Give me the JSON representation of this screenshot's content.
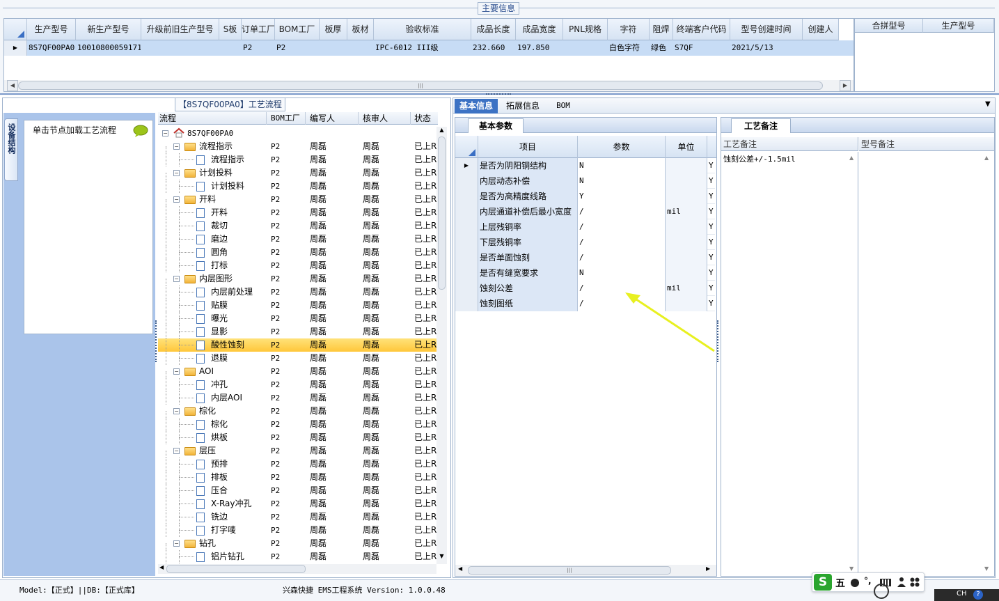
{
  "top": {
    "section_title": "主要信息",
    "columns": [
      "生产型号",
      "新生产型号",
      "升级前旧生产型号",
      "S板",
      "订单工厂",
      "BOM工厂",
      "板厚",
      "板材",
      "验收标准",
      "成品长度",
      "成品宽度",
      "PNL规格",
      "字符",
      "阻焊",
      "终端客户代码",
      "型号创建时间",
      "创建人"
    ],
    "row": [
      "8S7QF00PA0",
      "10010800059171",
      "",
      "",
      "P2",
      "P2",
      "",
      "",
      "IPC-6012 III级",
      "232.660",
      "197.850",
      "",
      "白色字符",
      "绿色",
      "S7QF",
      "2021/5/13",
      ""
    ],
    "side_columns": [
      "合拼型号",
      "生产型号"
    ]
  },
  "left_panel": {
    "vtab": "设备结构",
    "hint": "单击节点加载工艺流程",
    "flow_title": "【8S7QF00PA0】工艺流程",
    "columns": [
      "流程",
      "BOM工厂",
      "编写人",
      "核审人",
      "状态"
    ],
    "root": "8S7QF00PA0",
    "rows": [
      {
        "label": "流程指示",
        "type": "folder",
        "f": "P2",
        "w": "周磊",
        "r": "周磊",
        "s": "已上R"
      },
      {
        "label": "流程指示",
        "type": "file",
        "f": "P2",
        "w": "周磊",
        "r": "周磊",
        "s": "已上R"
      },
      {
        "label": "计划投料",
        "type": "folder",
        "f": "P2",
        "w": "周磊",
        "r": "周磊",
        "s": "已上R"
      },
      {
        "label": "计划投料",
        "type": "file",
        "f": "P2",
        "w": "周磊",
        "r": "周磊",
        "s": "已上R"
      },
      {
        "label": "开料",
        "type": "folder",
        "f": "P2",
        "w": "周磊",
        "r": "周磊",
        "s": "已上R"
      },
      {
        "label": "开料",
        "type": "file",
        "f": "P2",
        "w": "周磊",
        "r": "周磊",
        "s": "已上R"
      },
      {
        "label": "裁切",
        "type": "file",
        "f": "P2",
        "w": "周磊",
        "r": "周磊",
        "s": "已上R"
      },
      {
        "label": "磨边",
        "type": "file",
        "f": "P2",
        "w": "周磊",
        "r": "周磊",
        "s": "已上R"
      },
      {
        "label": "圆角",
        "type": "file",
        "f": "P2",
        "w": "周磊",
        "r": "周磊",
        "s": "已上R"
      },
      {
        "label": "打标",
        "type": "file",
        "f": "P2",
        "w": "周磊",
        "r": "周磊",
        "s": "已上R"
      },
      {
        "label": "内层图形",
        "type": "folder",
        "f": "P2",
        "w": "周磊",
        "r": "周磊",
        "s": "已上R"
      },
      {
        "label": "内层前处理",
        "type": "file",
        "f": "P2",
        "w": "周磊",
        "r": "周磊",
        "s": "已上R"
      },
      {
        "label": "贴膜",
        "type": "file",
        "f": "P2",
        "w": "周磊",
        "r": "周磊",
        "s": "已上R"
      },
      {
        "label": "曝光",
        "type": "file",
        "f": "P2",
        "w": "周磊",
        "r": "周磊",
        "s": "已上R"
      },
      {
        "label": "显影",
        "type": "file",
        "f": "P2",
        "w": "周磊",
        "r": "周磊",
        "s": "已上R"
      },
      {
        "label": "酸性蚀刻",
        "type": "file",
        "f": "P2",
        "w": "周磊",
        "r": "周磊",
        "s": "已上R",
        "sel": true
      },
      {
        "label": "退膜",
        "type": "file",
        "f": "P2",
        "w": "周磊",
        "r": "周磊",
        "s": "已上R"
      },
      {
        "label": "AOI",
        "type": "folder",
        "f": "P2",
        "w": "周磊",
        "r": "周磊",
        "s": "已上R"
      },
      {
        "label": "冲孔",
        "type": "file",
        "f": "P2",
        "w": "周磊",
        "r": "周磊",
        "s": "已上R"
      },
      {
        "label": "内层AOI",
        "type": "file",
        "f": "P2",
        "w": "周磊",
        "r": "周磊",
        "s": "已上R"
      },
      {
        "label": "棕化",
        "type": "folder",
        "f": "P2",
        "w": "周磊",
        "r": "周磊",
        "s": "已上R"
      },
      {
        "label": "棕化",
        "type": "file",
        "f": "P2",
        "w": "周磊",
        "r": "周磊",
        "s": "已上R"
      },
      {
        "label": "烘板",
        "type": "file",
        "f": "P2",
        "w": "周磊",
        "r": "周磊",
        "s": "已上R"
      },
      {
        "label": "层压",
        "type": "folder",
        "f": "P2",
        "w": "周磊",
        "r": "周磊",
        "s": "已上R"
      },
      {
        "label": "预排",
        "type": "file",
        "f": "P2",
        "w": "周磊",
        "r": "周磊",
        "s": "已上R"
      },
      {
        "label": "排板",
        "type": "file",
        "f": "P2",
        "w": "周磊",
        "r": "周磊",
        "s": "已上R"
      },
      {
        "label": "压合",
        "type": "file",
        "f": "P2",
        "w": "周磊",
        "r": "周磊",
        "s": "已上R"
      },
      {
        "label": "X-Ray冲孔",
        "type": "file",
        "f": "P2",
        "w": "周磊",
        "r": "周磊",
        "s": "已上R"
      },
      {
        "label": "铣边",
        "type": "file",
        "f": "P2",
        "w": "周磊",
        "r": "周磊",
        "s": "已上R"
      },
      {
        "label": "打字唛",
        "type": "file",
        "f": "P2",
        "w": "周磊",
        "r": "周磊",
        "s": "已上R"
      },
      {
        "label": "钻孔",
        "type": "folder",
        "f": "P2",
        "w": "周磊",
        "r": "周磊",
        "s": "已上R"
      },
      {
        "label": "铝片钻孔",
        "type": "file",
        "f": "P2",
        "w": "周磊",
        "r": "周磊",
        "s": "已上R"
      }
    ]
  },
  "right_panel": {
    "tabs": [
      "基本信息",
      "拓展信息",
      "BOM"
    ],
    "sub_tab": "基本参数",
    "param_columns": [
      "项目",
      "参数",
      "单位"
    ],
    "params": [
      {
        "item": "是否为阴阳铜结构",
        "value": "N",
        "unit": "",
        "flag": "Y"
      },
      {
        "item": "内层动态补偿",
        "value": "N",
        "unit": "",
        "flag": "Y"
      },
      {
        "item": "是否为高精度线路",
        "value": "Y",
        "unit": "",
        "flag": "Y"
      },
      {
        "item": "内层通道补偿后最小宽度",
        "value": "/",
        "unit": "mil",
        "flag": "Y"
      },
      {
        "item": "上层残铜率",
        "value": "/",
        "unit": "",
        "flag": "Y"
      },
      {
        "item": "下层残铜率",
        "value": "/",
        "unit": "",
        "flag": "Y"
      },
      {
        "item": "是否单面蚀刻",
        "value": "/",
        "unit": "",
        "flag": "Y"
      },
      {
        "item": "是否有缝宽要求",
        "value": "N",
        "unit": "",
        "flag": "Y"
      },
      {
        "item": "蚀刻公差",
        "value": "/",
        "unit": "mil",
        "flag": "Y"
      },
      {
        "item": "蚀刻图纸",
        "value": "/",
        "unit": "",
        "flag": "Y"
      }
    ],
    "remark_tab": "工艺备注",
    "remark_columns": [
      "工艺备注",
      "型号备注"
    ],
    "remark_text": "蚀刻公差+/-1.5mil"
  },
  "status": {
    "model": "Model:【正式】||DB:【正式库】",
    "app": "兴森快捷 EMS工程系统 Version: 1.0.0.48"
  },
  "ime": {
    "mode": "五",
    "icons": [
      "moon-icon",
      "punct-icon",
      "keyboard-icon",
      "user-icon",
      "grid-icon"
    ]
  },
  "colors": {
    "header": "#d6e3f3",
    "selection": "#c7dcf5",
    "tree_highlight": "#ffd24d",
    "panel_blue": "#aac4ea",
    "arrow": "#e8f020"
  }
}
